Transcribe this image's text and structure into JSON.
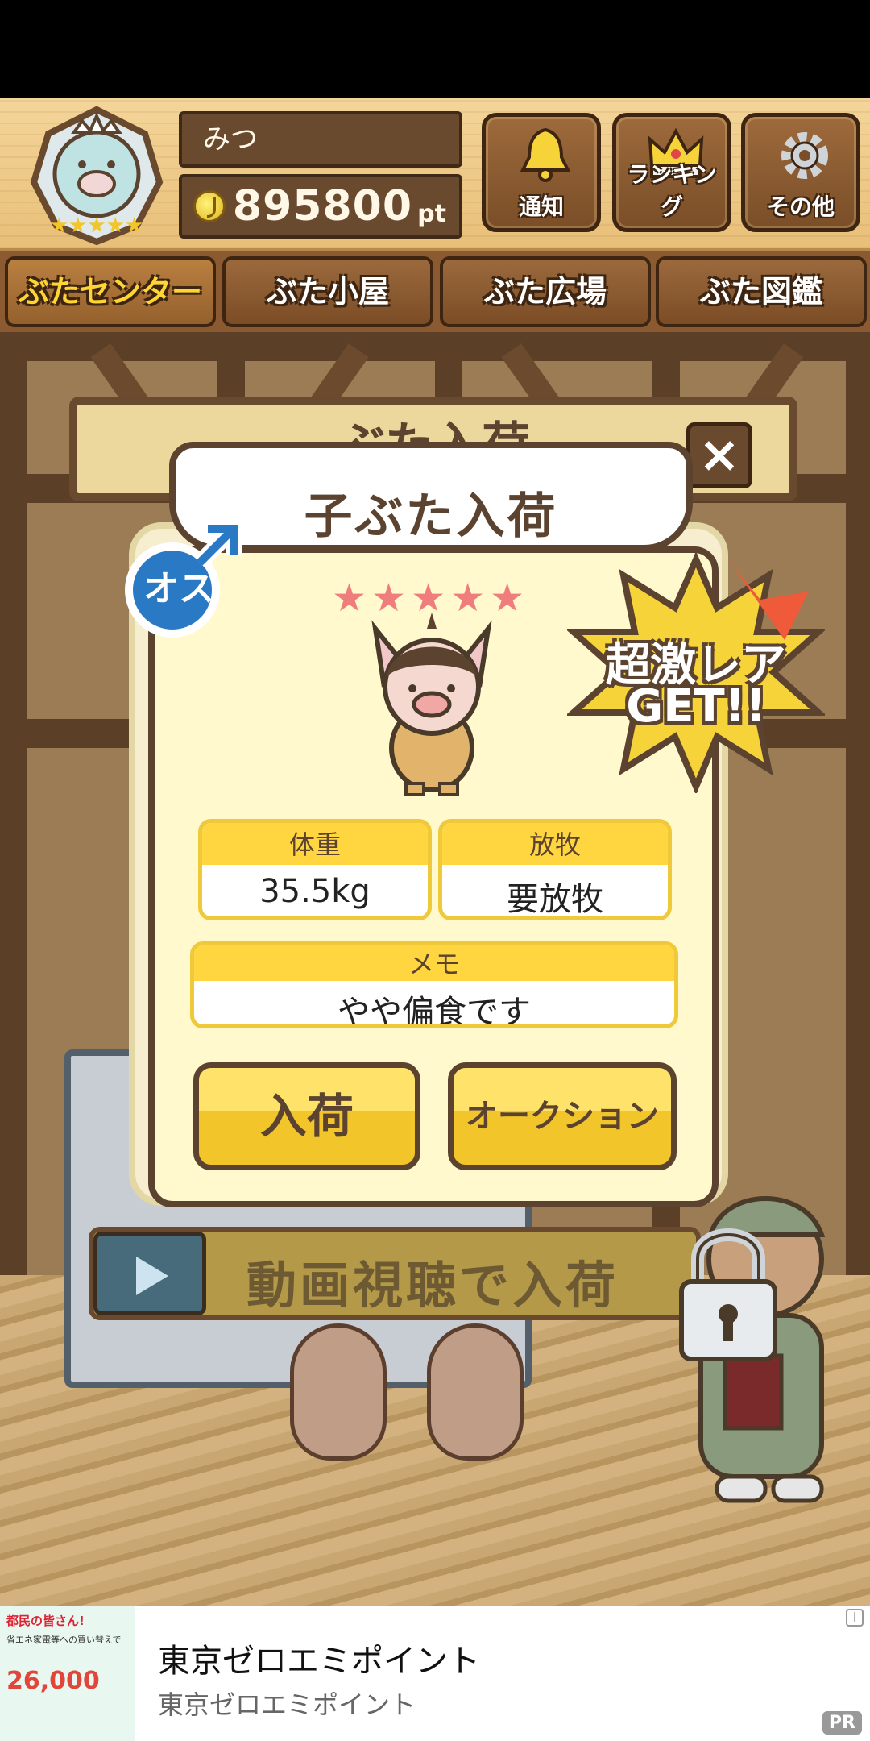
{
  "header": {
    "player_name": "みつ",
    "points": "895800",
    "points_unit": "pt",
    "buttons": {
      "notify": "通知",
      "ranking": "ランキング",
      "other": "その他"
    }
  },
  "tabs": [
    {
      "label": "ぶたセンター",
      "active": true
    },
    {
      "label": "ぶた小屋",
      "active": false
    },
    {
      "label": "ぶた広場",
      "active": false
    },
    {
      "label": "ぶた図鑑",
      "active": false
    }
  ],
  "background": {
    "panel_title": "ぶた入荷",
    "video_button": "動画視聴で入荷"
  },
  "modal": {
    "title": "子ぶた入荷",
    "gender": "オス",
    "stars": "★★★★★",
    "rarity_line1": "超激レア",
    "rarity_line2": "GET!!",
    "weight_label": "体重",
    "weight_value": "35.5kg",
    "grazing_label": "放牧",
    "grazing_value": "要放牧",
    "memo_label": "メモ",
    "memo_value": "やや偏食です",
    "accept_button": "入荷",
    "auction_button": "オークション"
  },
  "ad": {
    "title": "東京ゼロエミポイント",
    "subtitle": "東京ゼロエミポイント",
    "pr": "PR",
    "info": "i",
    "thumb_line1": "都民の皆さん!",
    "thumb_line2": "省エネ家電等への買い替えで",
    "thumb_amount": "26,000"
  },
  "colors": {
    "accent_yellow": "#ffd640",
    "wood_dark": "#5b4330",
    "modal_bg": "#fff9cd",
    "star_pink": "#ef7d7d",
    "tab_active_text": "#ffd534"
  }
}
